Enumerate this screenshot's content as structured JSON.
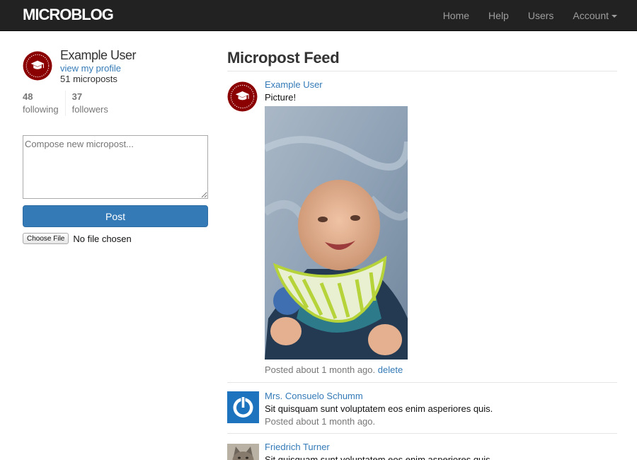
{
  "navbar": {
    "brand": "MICROBLOG",
    "links": [
      {
        "label": "Home"
      },
      {
        "label": "Help"
      },
      {
        "label": "Users"
      },
      {
        "label": "Account"
      }
    ]
  },
  "sidebar": {
    "user_name": "Example User",
    "profile_link": "view my profile",
    "micropost_count": "51 microposts",
    "following_count": "48",
    "following_label": "following",
    "followers_count": "37",
    "followers_label": "followers",
    "compose_placeholder": "Compose new micropost...",
    "post_button": "Post",
    "file_button": "Choose File",
    "file_status": "No file chosen"
  },
  "feed": {
    "title": "Micropost Feed",
    "posts": [
      {
        "user": "Example User",
        "content": "Picture!",
        "timestamp": "Posted about 1 month ago.",
        "delete_label": "delete",
        "avatar_icon": "graduation-cap-seal-icon"
      },
      {
        "user": "Mrs. Consuelo Schumm",
        "content": "Sit quisquam sunt voluptatem eos enim asperiores quis.",
        "timestamp": "Posted about 1 month ago.",
        "avatar_icon": "power-icon"
      },
      {
        "user": "Friedrich Turner",
        "content": "Sit quisquam sunt voluptatem eos enim asperiores quis.",
        "avatar_icon": "cat-photo"
      }
    ]
  },
  "colors": {
    "navbar_bg": "#222222",
    "link": "#337ab7",
    "seal": "#8b0000",
    "primary_button": "#337ab7"
  }
}
